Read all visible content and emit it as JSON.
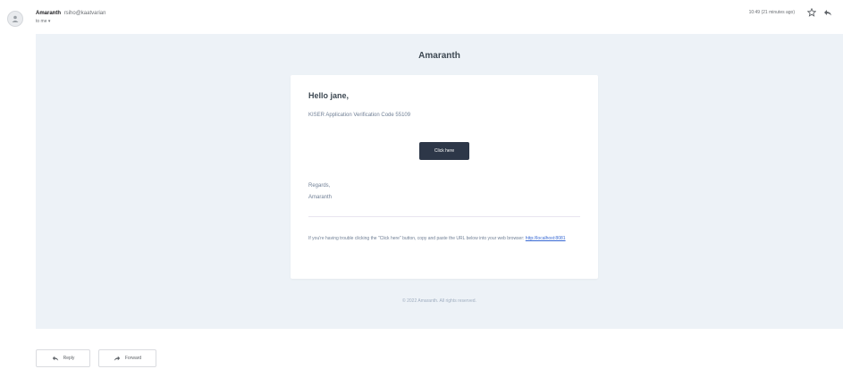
{
  "header": {
    "sender_name": "Amaranth",
    "sender_email": "rsiho@kaatvarian",
    "to_line": "to me ▾",
    "time": "10:49 (21 minutes ago)"
  },
  "email": {
    "brand": "Amaranth",
    "greeting": "Hello jane,",
    "code_line": "KISER Application Verification Code 55109",
    "button_label": "Click here",
    "regards": "Regards,",
    "signature": "Amaranth",
    "subcopy_text": "If you're having trouble clicking the \"Click here\" button, copy and paste the URL below into your web browser:",
    "subcopy_link": "http://localhost:8081",
    "footer": "© 2022 Amaranth. All rights reserved."
  },
  "actions": {
    "reply_label": "Reply",
    "forward_label": "Forward"
  }
}
